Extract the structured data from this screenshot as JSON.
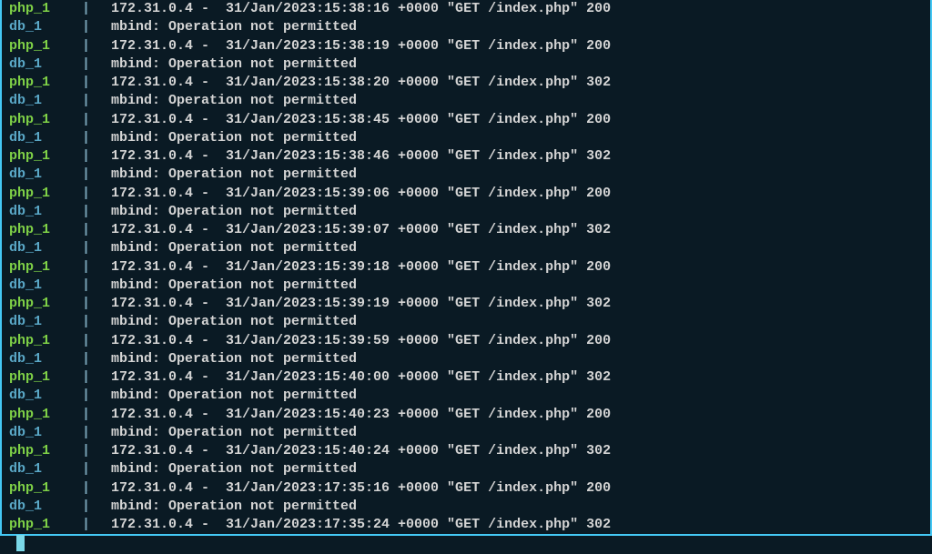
{
  "terminal": {
    "cursor": true,
    "lines": [
      {
        "src": "php_1",
        "msg": "172.31.0.4 -  31/Jan/2023:15:38:16 +0000 \"GET /index.php\" 200"
      },
      {
        "src": "db_1",
        "msg": "mbind: Operation not permitted"
      },
      {
        "src": "php_1",
        "msg": "172.31.0.4 -  31/Jan/2023:15:38:19 +0000 \"GET /index.php\" 200"
      },
      {
        "src": "db_1",
        "msg": "mbind: Operation not permitted"
      },
      {
        "src": "php_1",
        "msg": "172.31.0.4 -  31/Jan/2023:15:38:20 +0000 \"GET /index.php\" 302"
      },
      {
        "src": "db_1",
        "msg": "mbind: Operation not permitted"
      },
      {
        "src": "php_1",
        "msg": "172.31.0.4 -  31/Jan/2023:15:38:45 +0000 \"GET /index.php\" 200"
      },
      {
        "src": "db_1",
        "msg": "mbind: Operation not permitted"
      },
      {
        "src": "php_1",
        "msg": "172.31.0.4 -  31/Jan/2023:15:38:46 +0000 \"GET /index.php\" 302"
      },
      {
        "src": "db_1",
        "msg": "mbind: Operation not permitted"
      },
      {
        "src": "php_1",
        "msg": "172.31.0.4 -  31/Jan/2023:15:39:06 +0000 \"GET /index.php\" 200"
      },
      {
        "src": "db_1",
        "msg": "mbind: Operation not permitted"
      },
      {
        "src": "php_1",
        "msg": "172.31.0.4 -  31/Jan/2023:15:39:07 +0000 \"GET /index.php\" 302"
      },
      {
        "src": "db_1",
        "msg": "mbind: Operation not permitted"
      },
      {
        "src": "php_1",
        "msg": "172.31.0.4 -  31/Jan/2023:15:39:18 +0000 \"GET /index.php\" 200"
      },
      {
        "src": "db_1",
        "msg": "mbind: Operation not permitted"
      },
      {
        "src": "php_1",
        "msg": "172.31.0.4 -  31/Jan/2023:15:39:19 +0000 \"GET /index.php\" 302"
      },
      {
        "src": "db_1",
        "msg": "mbind: Operation not permitted"
      },
      {
        "src": "php_1",
        "msg": "172.31.0.4 -  31/Jan/2023:15:39:59 +0000 \"GET /index.php\" 200"
      },
      {
        "src": "db_1",
        "msg": "mbind: Operation not permitted"
      },
      {
        "src": "php_1",
        "msg": "172.31.0.4 -  31/Jan/2023:15:40:00 +0000 \"GET /index.php\" 302"
      },
      {
        "src": "db_1",
        "msg": "mbind: Operation not permitted"
      },
      {
        "src": "php_1",
        "msg": "172.31.0.4 -  31/Jan/2023:15:40:23 +0000 \"GET /index.php\" 200"
      },
      {
        "src": "db_1",
        "msg": "mbind: Operation not permitted"
      },
      {
        "src": "php_1",
        "msg": "172.31.0.4 -  31/Jan/2023:15:40:24 +0000 \"GET /index.php\" 302"
      },
      {
        "src": "db_1",
        "msg": "mbind: Operation not permitted"
      },
      {
        "src": "php_1",
        "msg": "172.31.0.4 -  31/Jan/2023:17:35:16 +0000 \"GET /index.php\" 200"
      },
      {
        "src": "db_1",
        "msg": "mbind: Operation not permitted"
      },
      {
        "src": "php_1",
        "msg": "172.31.0.4 -  31/Jan/2023:17:35:24 +0000 \"GET /index.php\" 302"
      }
    ]
  },
  "colors": {
    "php": "#7fd147",
    "db": "#5aa8c7",
    "pipe": "#7aa5b8",
    "text": "#d4d4d4",
    "bg": "#0a1a24",
    "cursor": "#7ad8e8",
    "border": "#44c8f5"
  }
}
